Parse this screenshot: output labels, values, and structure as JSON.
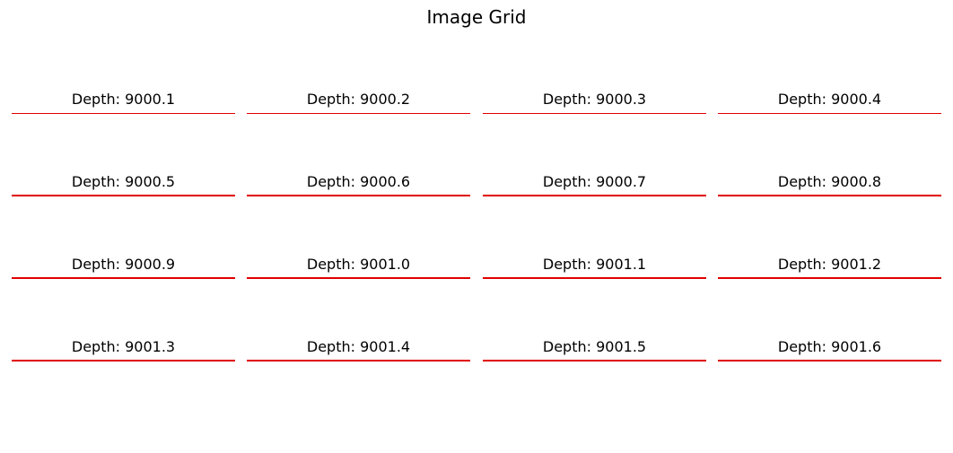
{
  "title": "Image Grid",
  "chart_data": {
    "type": "image-grid",
    "title": "Image Grid",
    "rows": 4,
    "cols": 4,
    "line_color": "#e00000",
    "panels": [
      {
        "title": "Depth: 9000.1"
      },
      {
        "title": "Depth: 9000.2"
      },
      {
        "title": "Depth: 9000.3"
      },
      {
        "title": "Depth: 9000.4"
      },
      {
        "title": "Depth: 9000.5"
      },
      {
        "title": "Depth: 9000.6"
      },
      {
        "title": "Depth: 9000.7"
      },
      {
        "title": "Depth: 9000.8"
      },
      {
        "title": "Depth: 9000.9"
      },
      {
        "title": "Depth: 9001.0"
      },
      {
        "title": "Depth: 9001.1"
      },
      {
        "title": "Depth: 9001.2"
      },
      {
        "title": "Depth: 9001.3"
      },
      {
        "title": "Depth: 9001.4"
      },
      {
        "title": "Depth: 9001.5"
      },
      {
        "title": "Depth: 9001.6"
      }
    ]
  }
}
